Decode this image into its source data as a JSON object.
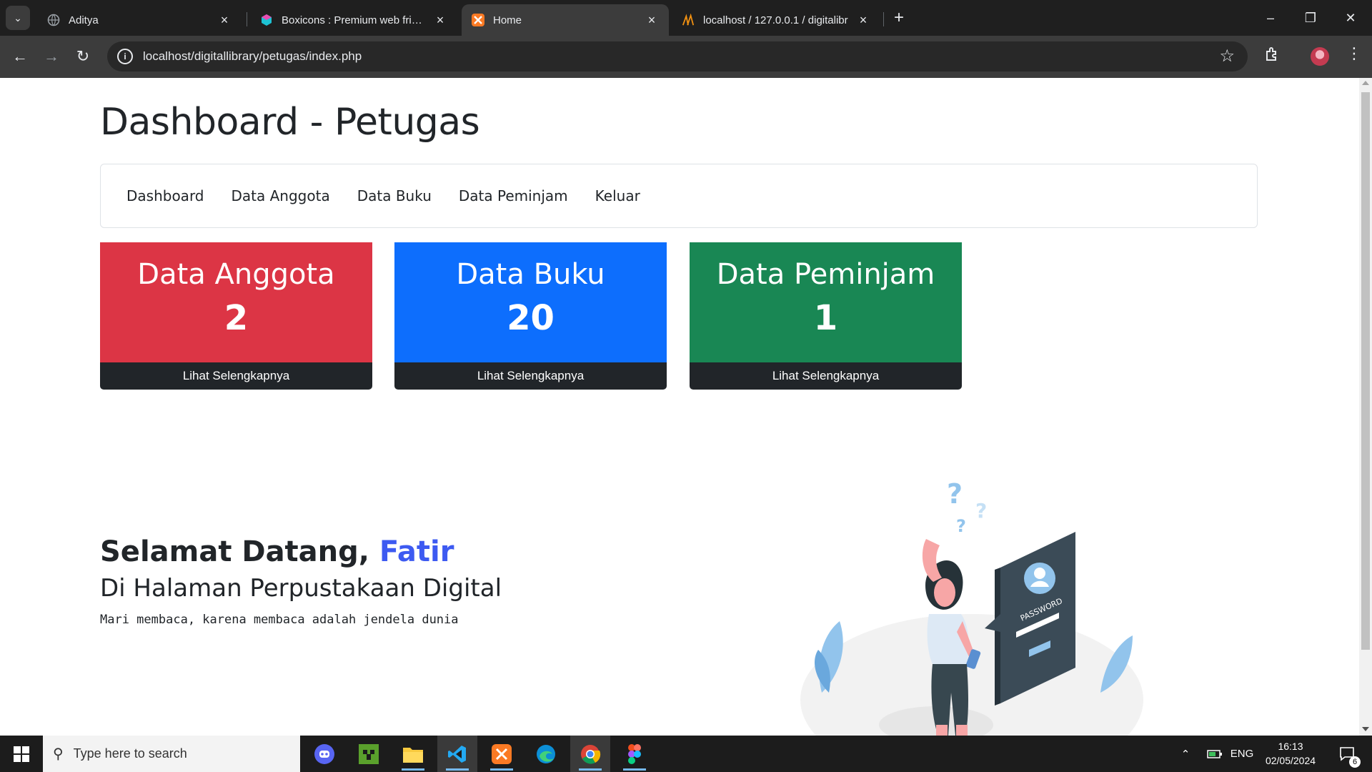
{
  "browser": {
    "tabs": [
      {
        "title": "Aditya",
        "active": false
      },
      {
        "title": "Boxicons : Premium web friendl",
        "active": false
      },
      {
        "title": "Home",
        "active": true
      },
      {
        "title": "localhost / 127.0.0.1 / digitalibr",
        "active": false
      }
    ],
    "url": "localhost/digitallibrary/petugas/index.php"
  },
  "page": {
    "title": "Dashboard - Petugas",
    "nav": [
      "Dashboard",
      "Data Anggota",
      "Data Buku",
      "Data Peminjam",
      "Keluar"
    ],
    "cards": [
      {
        "title": "Data Anggota",
        "count": "2",
        "footer": "Lihat Selengkapnya",
        "color": "#dc3545"
      },
      {
        "title": "Data Buku",
        "count": "20",
        "footer": "Lihat Selengkapnya",
        "color": "#0d6efd"
      },
      {
        "title": "Data Peminjam",
        "count": "1",
        "footer": "Lihat Selengkapnya",
        "color": "#198754"
      }
    ],
    "welcome": {
      "greeting": "Selamat Datang,",
      "name": "Fatir",
      "subtitle": "Di Halaman Perpustakaan Digital",
      "tagline": "Mari membaca, karena membaca adalah jendela dunia"
    },
    "illustration_text": "PASSWORD"
  },
  "taskbar": {
    "search_placeholder": "Type here to search",
    "language": "ENG",
    "time": "16:13",
    "date": "02/05/2024",
    "notifications": "6"
  }
}
